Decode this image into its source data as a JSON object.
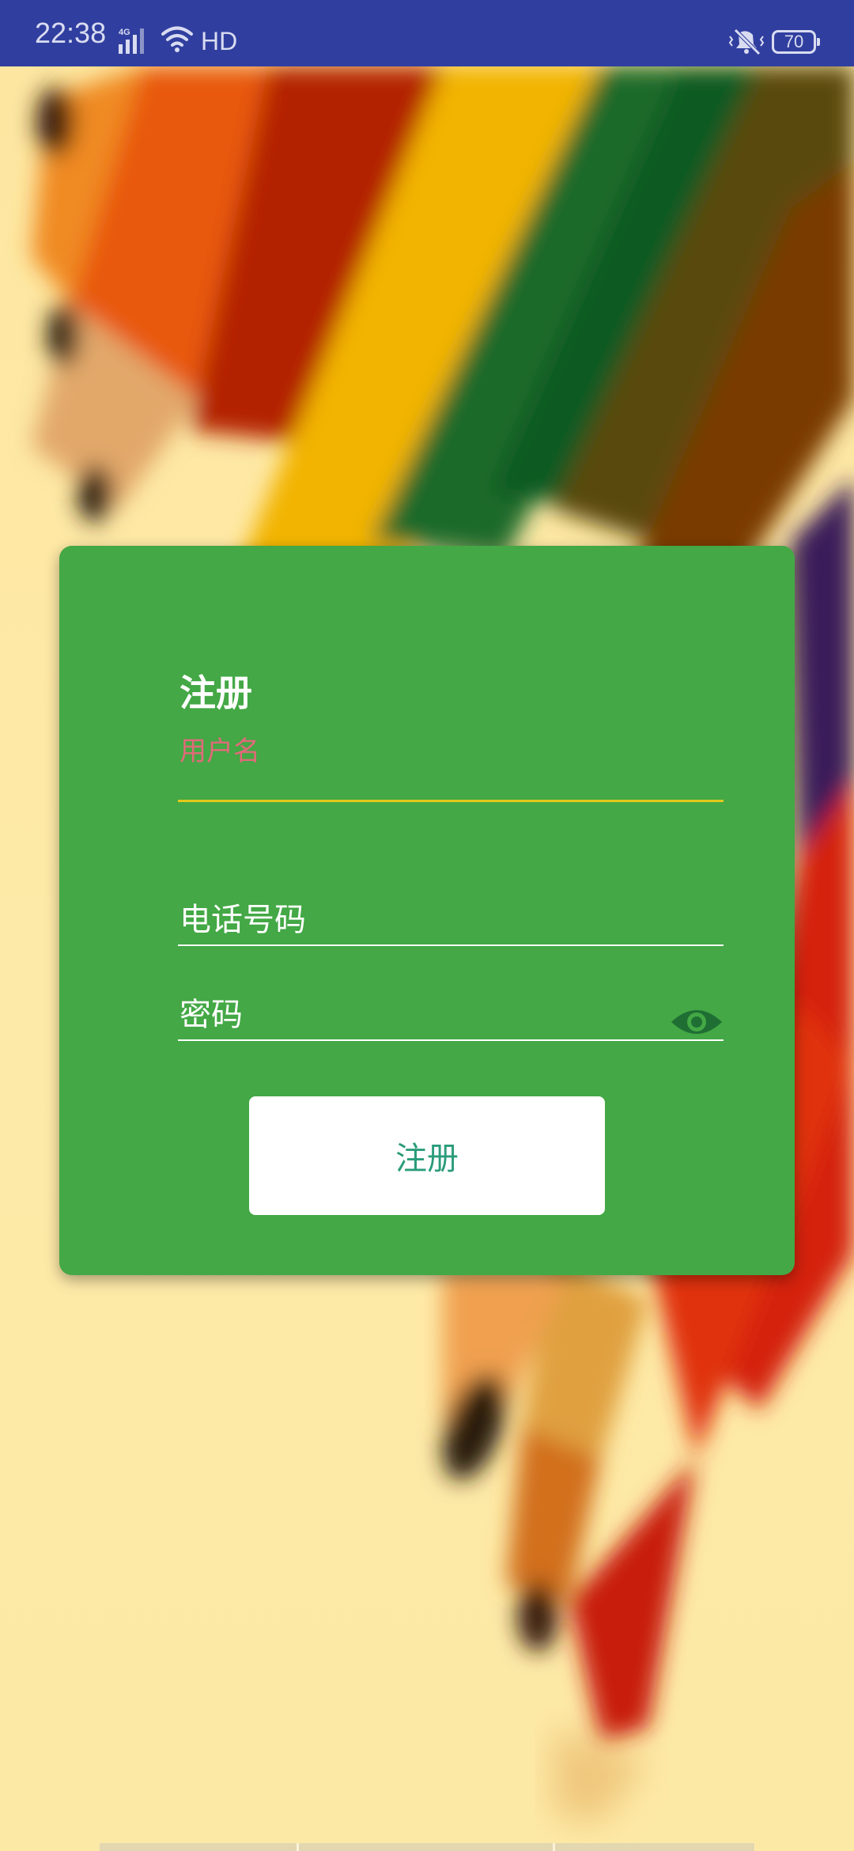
{
  "status_bar": {
    "time": "22:38",
    "network_label": "HD",
    "battery_level": "70",
    "signal_icon": "signal-4g-icon",
    "wifi_icon": "wifi-icon",
    "mute_icon": "vibrate-mute-icon"
  },
  "card": {
    "title": "注册",
    "username": {
      "label": "用户名",
      "value": ""
    },
    "phone": {
      "placeholder": "电话号码",
      "value": ""
    },
    "password": {
      "placeholder": "密码",
      "value": "",
      "toggle_icon": "eye-icon"
    },
    "submit_label": "注册"
  },
  "colors": {
    "status_bar": "#303f9f",
    "card": "#43a845",
    "focused_label": "#e06a7a",
    "focused_underline": "#e4c91c",
    "button_text": "#2b9c7a"
  }
}
